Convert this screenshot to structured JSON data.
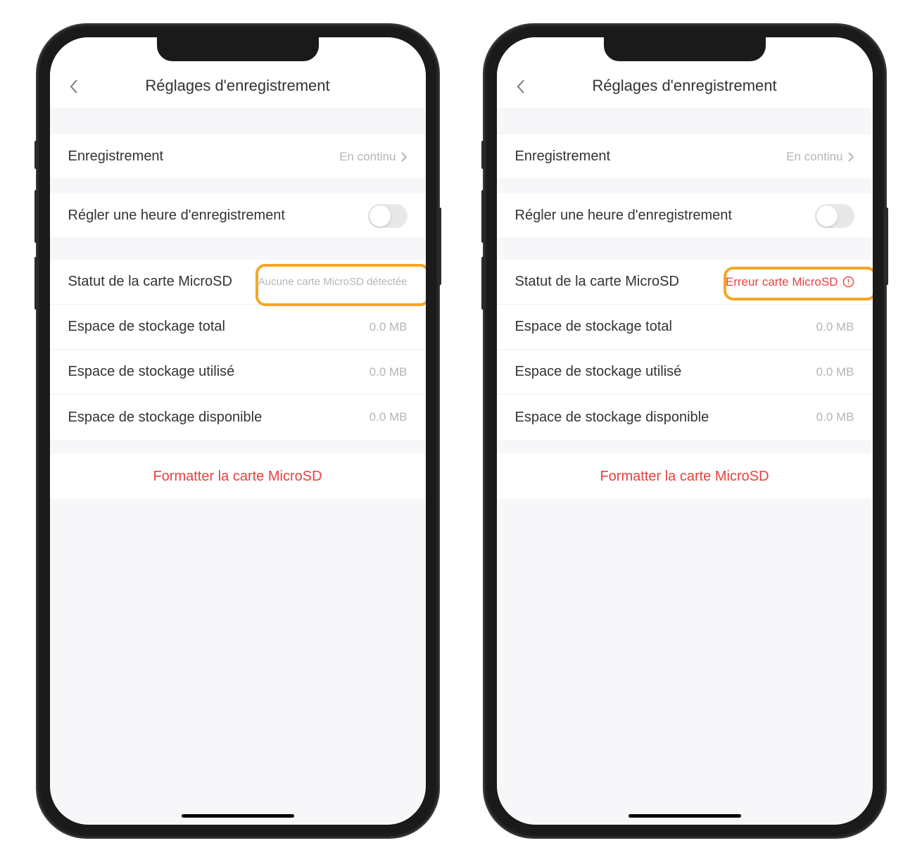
{
  "phones": [
    {
      "header": {
        "title": "Réglages d'enregistrement"
      },
      "recording": {
        "label": "Enregistrement",
        "value": "En continu"
      },
      "schedule": {
        "label": "Régler une heure d'enregistrement"
      },
      "sdStatus": {
        "label": "Statut de la carte MicroSD",
        "value": "Aucune carte MicroSD détectée",
        "error": false
      },
      "storageTotal": {
        "label": "Espace de stockage total",
        "value": "0.0 MB"
      },
      "storageUsed": {
        "label": "Espace de stockage utilisé",
        "value": "0.0 MB"
      },
      "storageFree": {
        "label": "Espace de stockage disponible",
        "value": "0.0 MB"
      },
      "format": {
        "label": "Formatter la carte MicroSD"
      }
    },
    {
      "header": {
        "title": "Réglages d'enregistrement"
      },
      "recording": {
        "label": "Enregistrement",
        "value": "En continu"
      },
      "schedule": {
        "label": "Régler une heure d'enregistrement"
      },
      "sdStatus": {
        "label": "Statut de la carte MicroSD",
        "value": "Erreur carte MicroSD",
        "error": true
      },
      "storageTotal": {
        "label": "Espace de stockage total",
        "value": "0.0 MB"
      },
      "storageUsed": {
        "label": "Espace de stockage utilisé",
        "value": "0.0 MB"
      },
      "storageFree": {
        "label": "Espace de stockage disponible",
        "value": "0.0 MB"
      },
      "format": {
        "label": "Formatter la carte MicroSD"
      }
    }
  ]
}
